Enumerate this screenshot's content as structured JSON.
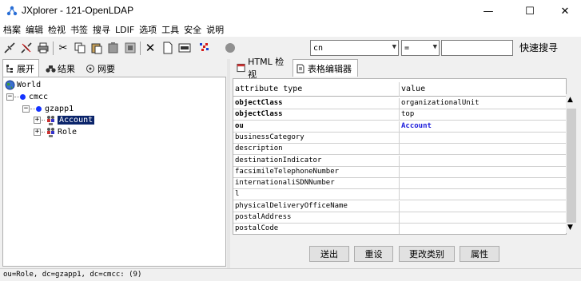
{
  "window": {
    "title": "JXplorer - 121-OpenLDAP",
    "min": "—",
    "max": "☐",
    "close": "✕"
  },
  "menu": [
    "档案",
    "编辑",
    "检视",
    "书签",
    "搜寻",
    "LDIF",
    "选项",
    "工具",
    "安全",
    "说明"
  ],
  "toolbar": {
    "attr_combo": "cn",
    "op_combo": "=",
    "search_value": "",
    "quick_search_label": "快速搜寻"
  },
  "left_tabs": [
    "展开",
    "结果",
    "网要"
  ],
  "tree": {
    "root": "World",
    "level1": "cmcc",
    "level2": "gzapp1",
    "items": [
      "Account",
      "Role"
    ]
  },
  "right_tabs": [
    "HTML 检视",
    "表格编辑器"
  ],
  "grid": {
    "header": {
      "attribute": "attribute type",
      "value": "value"
    },
    "rows": [
      {
        "attr": "objectClass",
        "value": "organizationalUnit",
        "style": "bold"
      },
      {
        "attr": "objectClass",
        "value": "top",
        "style": "bold"
      },
      {
        "attr": "ou",
        "value": "Account",
        "style": "blue"
      },
      {
        "attr": "businessCategory",
        "value": ""
      },
      {
        "attr": "description",
        "value": ""
      },
      {
        "attr": "destinationIndicator",
        "value": ""
      },
      {
        "attr": "facsimileTelephoneNumber",
        "value": ""
      },
      {
        "attr": "internationaliSDNNumber",
        "value": ""
      },
      {
        "attr": "l",
        "value": ""
      },
      {
        "attr": "physicalDeliveryOfficeName",
        "value": ""
      },
      {
        "attr": "postalAddress",
        "value": ""
      },
      {
        "attr": "postalCode",
        "value": ""
      }
    ]
  },
  "buttons": {
    "submit": "送出",
    "reset": "重设",
    "change_class": "更改类别",
    "properties": "属性"
  },
  "status": "ou=Role, dc=gzapp1, dc=cmcc: (9)",
  "colors": {
    "selection": "#0a246a",
    "node_dot": "#1433ff",
    "accent_value": "#1a1adb"
  }
}
